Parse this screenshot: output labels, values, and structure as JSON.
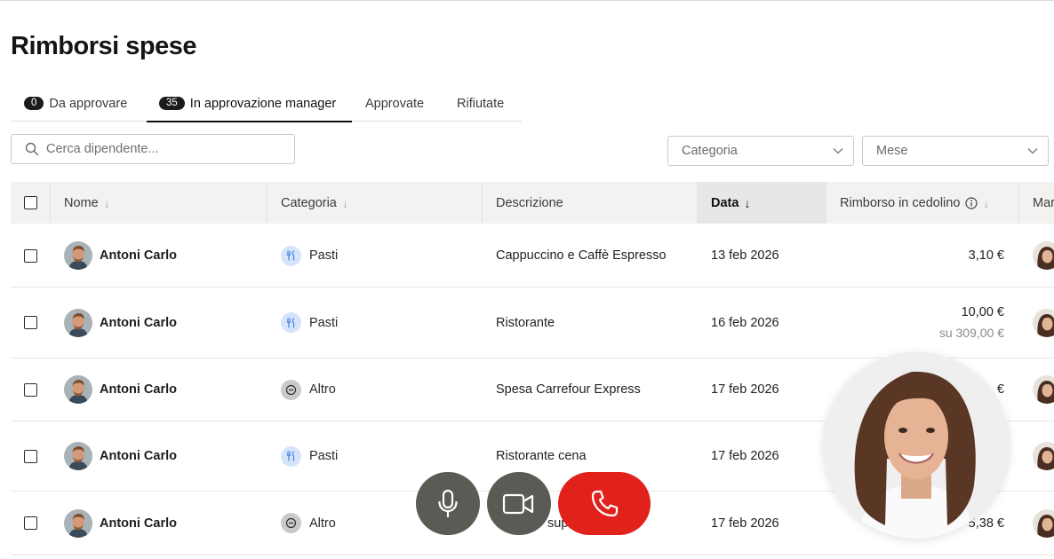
{
  "page": {
    "title": "Rimborsi spese"
  },
  "tabs": [
    {
      "badge": "0",
      "label": "Da approvare"
    },
    {
      "badge": "35",
      "label": "In approvazione manager",
      "active": true
    },
    {
      "label": "Approvate"
    },
    {
      "label": "Rifiutate"
    }
  ],
  "search": {
    "placeholder": "Cerca dipendente..."
  },
  "filters": {
    "category_placeholder": "Categoria",
    "month_placeholder": "Mese"
  },
  "table": {
    "columns": {
      "name": "Nome",
      "category": "Categoria",
      "description": "Descrizione",
      "date": "Data",
      "reimbursement": "Rimborso in cedolino",
      "manager": "Mar"
    },
    "rows": [
      {
        "name": "Antoni Carlo",
        "category": "Pasti",
        "category_icon": "fork-knife-icon",
        "description": "Cappuccino e Caffè Espresso",
        "date": "13 feb 2026",
        "amount": "3,10 €",
        "amount_sub": ""
      },
      {
        "name": "Antoni Carlo",
        "category": "Pasti",
        "category_icon": "fork-knife-icon",
        "description": "Ristorante",
        "date": "16 feb 2026",
        "amount": "10,00 €",
        "amount_sub": "su 309,00 €"
      },
      {
        "name": "Antoni Carlo",
        "category": "Altro",
        "category_icon": "minus-circle-icon",
        "description": "Spesa Carrefour Express",
        "date": "17 feb 2026",
        "amount": "€",
        "amount_sub": ""
      },
      {
        "name": "Antoni Carlo",
        "category": "Pasti",
        "category_icon": "fork-knife-icon",
        "description": "Ristorante cena",
        "date": "17 feb 2026",
        "amount": "",
        "amount_sub": ""
      },
      {
        "name": "Antoni Carlo",
        "category": "Altro",
        "category_icon": "minus-circle-icon",
        "description": "",
        "description_partial": "sup",
        "date": "17 feb 2026",
        "amount": "5,38 €",
        "amount_sub": ""
      }
    ]
  },
  "call_controls": {
    "mic": "microphone-icon",
    "camera": "video-camera-icon",
    "end": "phone-end-icon",
    "end_color": "#e1211b",
    "button_color": "#5b5a55"
  },
  "colors": {
    "pasti_icon_bg": "#d5e4fb",
    "altro_icon_bg": "#c9c9c9",
    "header_bg": "#f2f3f1"
  }
}
